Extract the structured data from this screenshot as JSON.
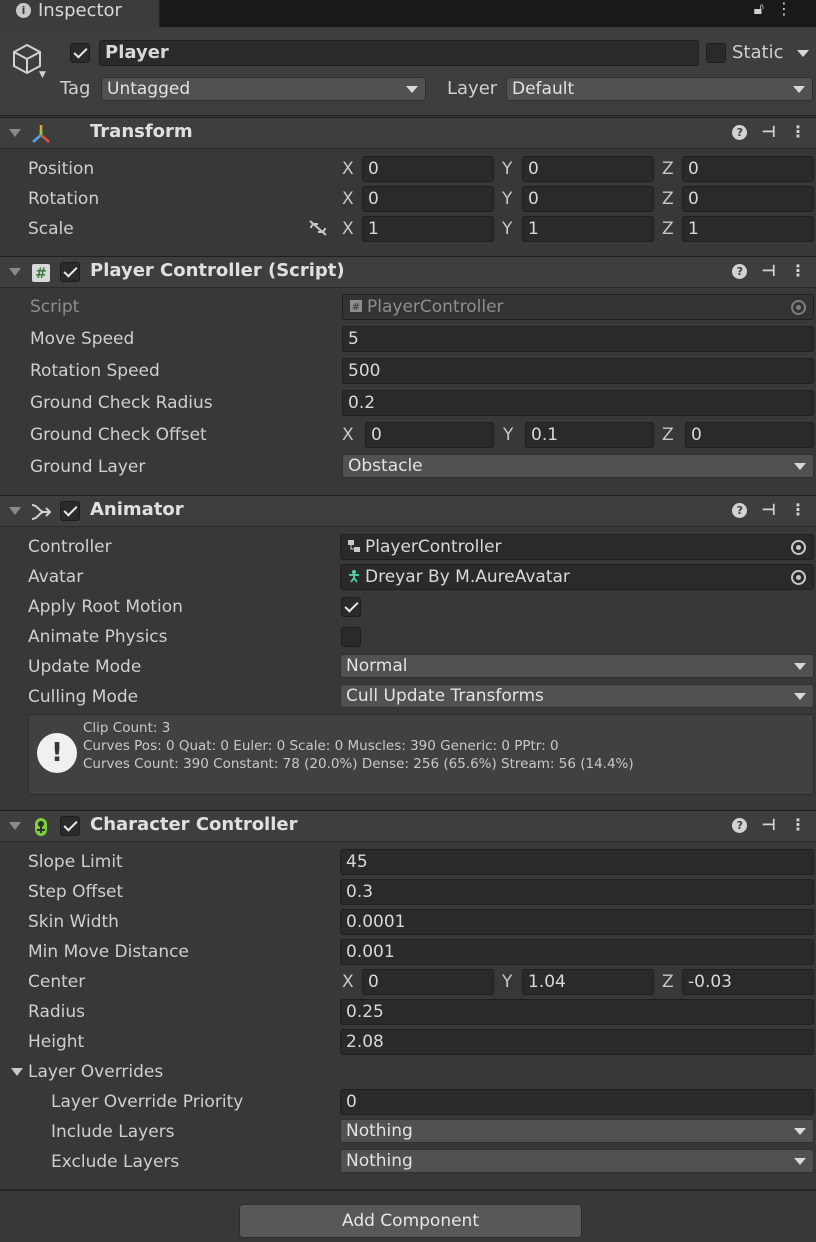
{
  "tab": {
    "title": "Inspector"
  },
  "header": {
    "name": "Player",
    "static_label": "Static",
    "tag_label": "Tag",
    "tag_value": "Untagged",
    "layer_label": "Layer",
    "layer_value": "Default"
  },
  "transform": {
    "title": "Transform",
    "rows": [
      {
        "label": "Position",
        "x": "0",
        "y": "0",
        "z": "0"
      },
      {
        "label": "Rotation",
        "x": "0",
        "y": "0",
        "z": "0"
      },
      {
        "label": "Scale",
        "x": "1",
        "y": "1",
        "z": "1"
      }
    ]
  },
  "axes": {
    "x": "X",
    "y": "Y",
    "z": "Z"
  },
  "player_controller": {
    "title": "Player Controller (Script)",
    "script_label": "Script",
    "script_value": "PlayerController",
    "move_speed_label": "Move Speed",
    "move_speed": "5",
    "rotation_speed_label": "Rotation Speed",
    "rotation_speed": "500",
    "gc_radius_label": "Ground Check Radius",
    "gc_radius": "0.2",
    "gc_offset_label": "Ground Check Offset",
    "gc_offset": {
      "x": "0",
      "y": "0.1",
      "z": "0"
    },
    "ground_layer_label": "Ground Layer",
    "ground_layer": "Obstacle"
  },
  "animator": {
    "title": "Animator",
    "controller_label": "Controller",
    "controller": "PlayerController",
    "avatar_label": "Avatar",
    "avatar": "Dreyar By M.AureAvatar",
    "apply_root_motion_label": "Apply Root Motion",
    "apply_root_motion": true,
    "animate_physics_label": "Animate Physics",
    "animate_physics": false,
    "update_mode_label": "Update Mode",
    "update_mode": "Normal",
    "culling_mode_label": "Culling Mode",
    "culling_mode": "Cull Update Transforms",
    "info_lines": [
      "Clip Count: 3",
      "Curves Pos: 0 Quat: 0 Euler: 0 Scale: 0 Muscles: 390 Generic: 0 PPtr: 0",
      "Curves Count: 390 Constant: 78 (20.0%) Dense: 256 (65.6%) Stream: 56 (14.4%)"
    ]
  },
  "character_controller": {
    "title": "Character Controller",
    "slope_limit_label": "Slope Limit",
    "slope_limit": "45",
    "step_offset_label": "Step Offset",
    "step_offset": "0.3",
    "skin_width_label": "Skin Width",
    "skin_width": "0.0001",
    "min_move_label": "Min Move Distance",
    "min_move": "0.001",
    "center_label": "Center",
    "center": {
      "x": "0",
      "y": "1.04",
      "z": "-0.03"
    },
    "radius_label": "Radius",
    "radius": "0.25",
    "height_label": "Height",
    "height": "2.08",
    "layer_overrides_label": "Layer Overrides",
    "priority_label": "Layer Override Priority",
    "priority": "0",
    "include_label": "Include Layers",
    "include": "Nothing",
    "exclude_label": "Exclude Layers",
    "exclude": "Nothing"
  },
  "add_component": "Add Component"
}
